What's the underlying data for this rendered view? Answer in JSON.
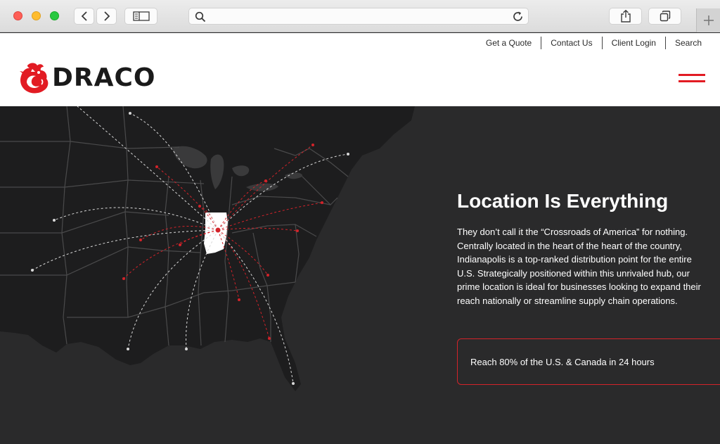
{
  "browser": {
    "back_icon": "chevron-left-icon",
    "forward_icon": "chevron-right-icon",
    "sidebar_icon": "sidebar-icon",
    "search_icon": "search-icon",
    "reload_icon": "reload-icon",
    "share_icon": "share-icon",
    "tabs_icon": "tabs-icon",
    "new_tab_icon": "plus-icon",
    "address_value": ""
  },
  "utility_nav": {
    "items": [
      "Get a Quote",
      "Contact Us",
      "Client Login",
      "Search"
    ]
  },
  "logo": {
    "text": "DRACO",
    "icon": "dragon-logo-icon",
    "accent": "#e21b23"
  },
  "menu": {
    "icon": "hamburger-menu-icon",
    "color": "#e21b23"
  },
  "hero": {
    "title": "Location Is Everything",
    "body": "They don’t call it the “Crossroads of America” for nothing. Centrally located in the heart of the heart of the country, Indianapolis is a top-ranked distribution point for the entire U.S. Strategically positioned within this unrivaled hub, our prime location is ideal for businesses looking to expand their reach nationally or streamline supply chain operations.",
    "callout": "Reach 80% of the U.S. & Canada in 24 hours",
    "map_icon": "us-distribution-map",
    "colors": {
      "background": "#2a2a2b",
      "accent": "#d3232a",
      "text": "#ffffff"
    }
  }
}
